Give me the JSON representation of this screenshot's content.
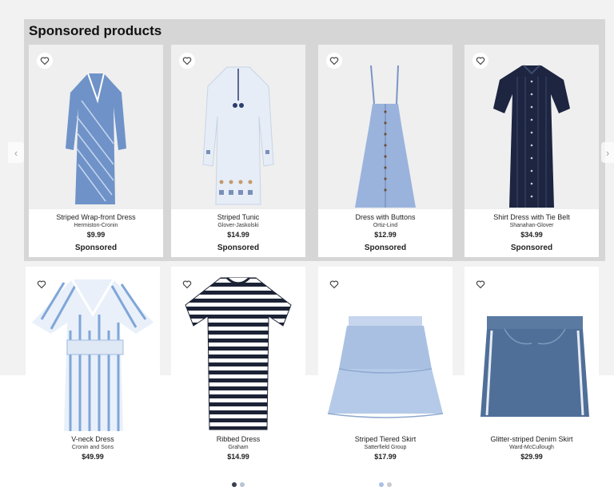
{
  "section": {
    "title": "Sponsored products"
  },
  "nav": {
    "prev_icon": "chevron-left-icon",
    "next_icon": "chevron-right-icon",
    "prev_glyph": "‹",
    "next_glyph": "›"
  },
  "sponsored_products": [
    {
      "name": "Striped Wrap-front Dress",
      "brand": "Hermiston-Cronin",
      "price": "$9.99",
      "tag": "Sponsored",
      "color": "#6f93c8"
    },
    {
      "name": "Striped Tunic",
      "brand": "Glover-Jaskolski",
      "price": "$14.99",
      "tag": "Sponsored",
      "color": "#dfe8f4"
    },
    {
      "name": "Dress with Buttons",
      "brand": "Ortiz-Lind",
      "price": "$12.99",
      "tag": "Sponsored",
      "color": "#9ab3dd"
    },
    {
      "name": "Shirt Dress with Tie Belt",
      "brand": "Shanahan-Glover",
      "price": "$34.99",
      "tag": "Sponsored",
      "color": "#1d2540"
    }
  ],
  "products": [
    {
      "name": "V-neck Dress",
      "brand": "Cronin and Sons",
      "price": "$49.99",
      "color": "#7fa6d8"
    },
    {
      "name": "Ribbed Dress",
      "brand": "Graham",
      "price": "$14.99",
      "color": "#1c2336",
      "swatches": [
        "#3a3f4f",
        "#b8c4d4"
      ]
    },
    {
      "name": "Striped Tiered Skirt",
      "brand": "Satterfield Group",
      "price": "$17.99",
      "color": "#a9c0e2",
      "swatches": [
        "#a9c0e2",
        "#c8ccd2"
      ]
    },
    {
      "name": "Glitter-striped Denim Skirt",
      "brand": "Ward-McCullough",
      "price": "$29.99",
      "color": "#4f6f98"
    }
  ]
}
